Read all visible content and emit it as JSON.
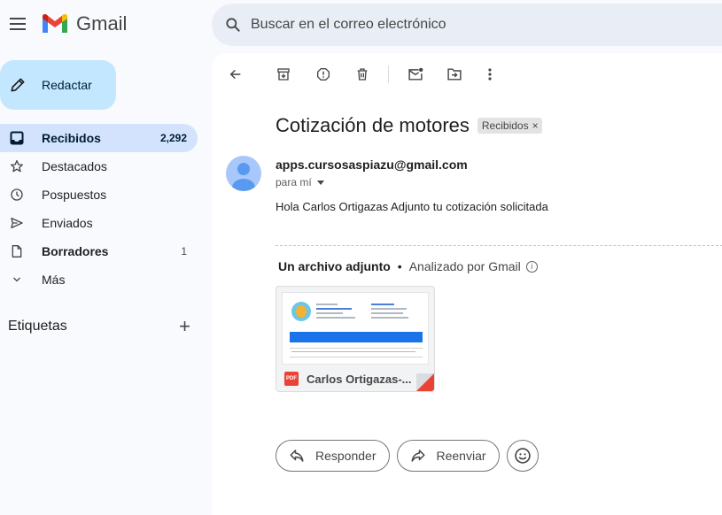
{
  "header": {
    "app_name": "Gmail",
    "search_placeholder": "Buscar en el correo electrónico"
  },
  "sidebar": {
    "compose_label": "Redactar",
    "items": [
      {
        "label": "Recibidos",
        "count": "2,292",
        "icon": "inbox-icon"
      },
      {
        "label": "Destacados",
        "count": "",
        "icon": "star-icon"
      },
      {
        "label": "Pospuestos",
        "count": "",
        "icon": "clock-icon"
      },
      {
        "label": "Enviados",
        "count": "",
        "icon": "send-icon"
      },
      {
        "label": "Borradores",
        "count": "1",
        "icon": "draft-icon"
      },
      {
        "label": "Más",
        "count": "",
        "icon": "chevron-down-icon"
      }
    ],
    "labels_title": "Etiquetas"
  },
  "message": {
    "subject": "Cotización de motores",
    "label_chip": "Recibidos",
    "sender": "apps.cursosaspiazu@gmail.com",
    "recipient_line": "para mí",
    "body": "Hola Carlos Ortigazas Adjunto tu cotización solicitada"
  },
  "attachments": {
    "title": "Un archivo adjunto",
    "scan_status": "Analizado por Gmail",
    "file_name": "Carlos Ortigazas-...",
    "file_type": "PDF"
  },
  "actions": {
    "reply": "Responder",
    "forward": "Reenviar"
  },
  "colors": {
    "accent": "#c2e7ff",
    "active_nav": "#d3e3fd",
    "pdf_red": "#ea4335"
  }
}
